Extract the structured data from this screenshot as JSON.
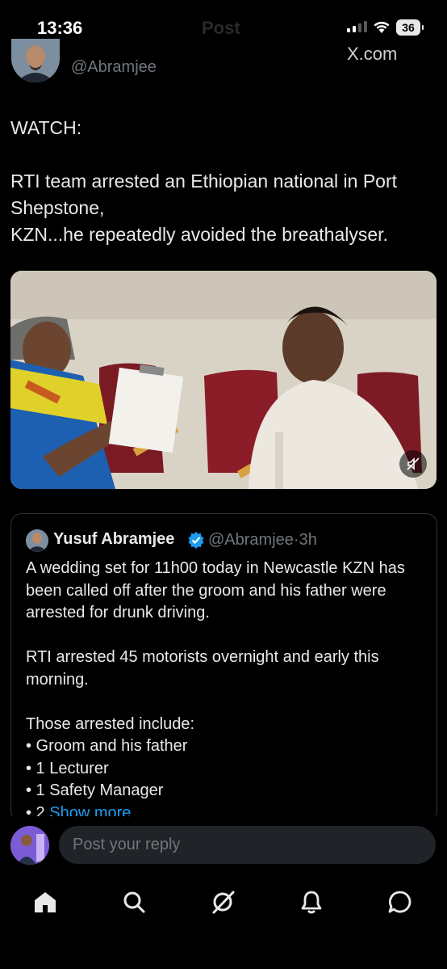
{
  "status_bar": {
    "time": "13:36",
    "ghost_title": "Post",
    "battery": "36"
  },
  "author": {
    "handle": "@Abramjee",
    "ghost_name": "X.com"
  },
  "tweet": {
    "line1": "WATCH:",
    "line2": "RTI team arrested an Ethiopian national in Port Shepstone,",
    "line3": "KZN...he repeatedly avoided the breathalyser."
  },
  "quote": {
    "name": "Yusuf Abramjee",
    "handle": "@Abramjee",
    "dot": "·",
    "time": "3h",
    "p1": "A wedding set for 11h00 today in Newcastle KZN has been called off after the groom and his father were arrested for drunk driving.",
    "p2": "RTI arrested 45 motorists overnight and early this morning.",
    "list_intro": "Those arrested include:",
    "item1": "• Groom and his father",
    "item2": "• 1 Lecturer",
    "item3": "• 1 Safety Manager",
    "item4_prefix": "• 2 ",
    "show_more": "Show more"
  },
  "reply": {
    "placeholder": "Post your reply"
  },
  "nav": {
    "icons": [
      "home-icon",
      "search-icon",
      "grok-icon",
      "notifications-icon",
      "messages-icon"
    ]
  },
  "colors": {
    "background": "#000000",
    "accent": "#1d9bf0",
    "muted": "#71767b",
    "text": "#e7e9ea"
  }
}
